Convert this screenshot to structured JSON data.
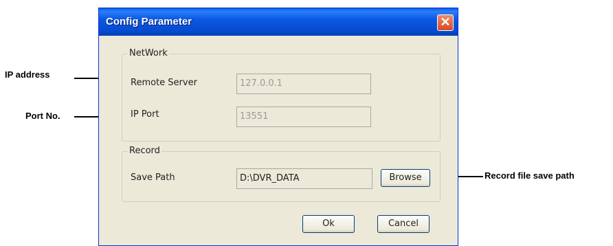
{
  "annotations": {
    "ip_address": "IP address",
    "port_no": "Port No.",
    "record_path": "Record file save path"
  },
  "dialog": {
    "title": "Config Parameter",
    "close_glyph": "✕",
    "network": {
      "legend": "NetWork",
      "remote_server_label": "Remote Server",
      "remote_server_value": "127.0.0.1",
      "ip_port_label": "IP Port",
      "ip_port_value": "13551"
    },
    "record": {
      "legend": "Record",
      "save_path_label": "Save Path",
      "save_path_value": "D:\\DVR_DATA",
      "browse_label": "Browse"
    },
    "ok_label": "Ok",
    "cancel_label": "Cancel"
  }
}
